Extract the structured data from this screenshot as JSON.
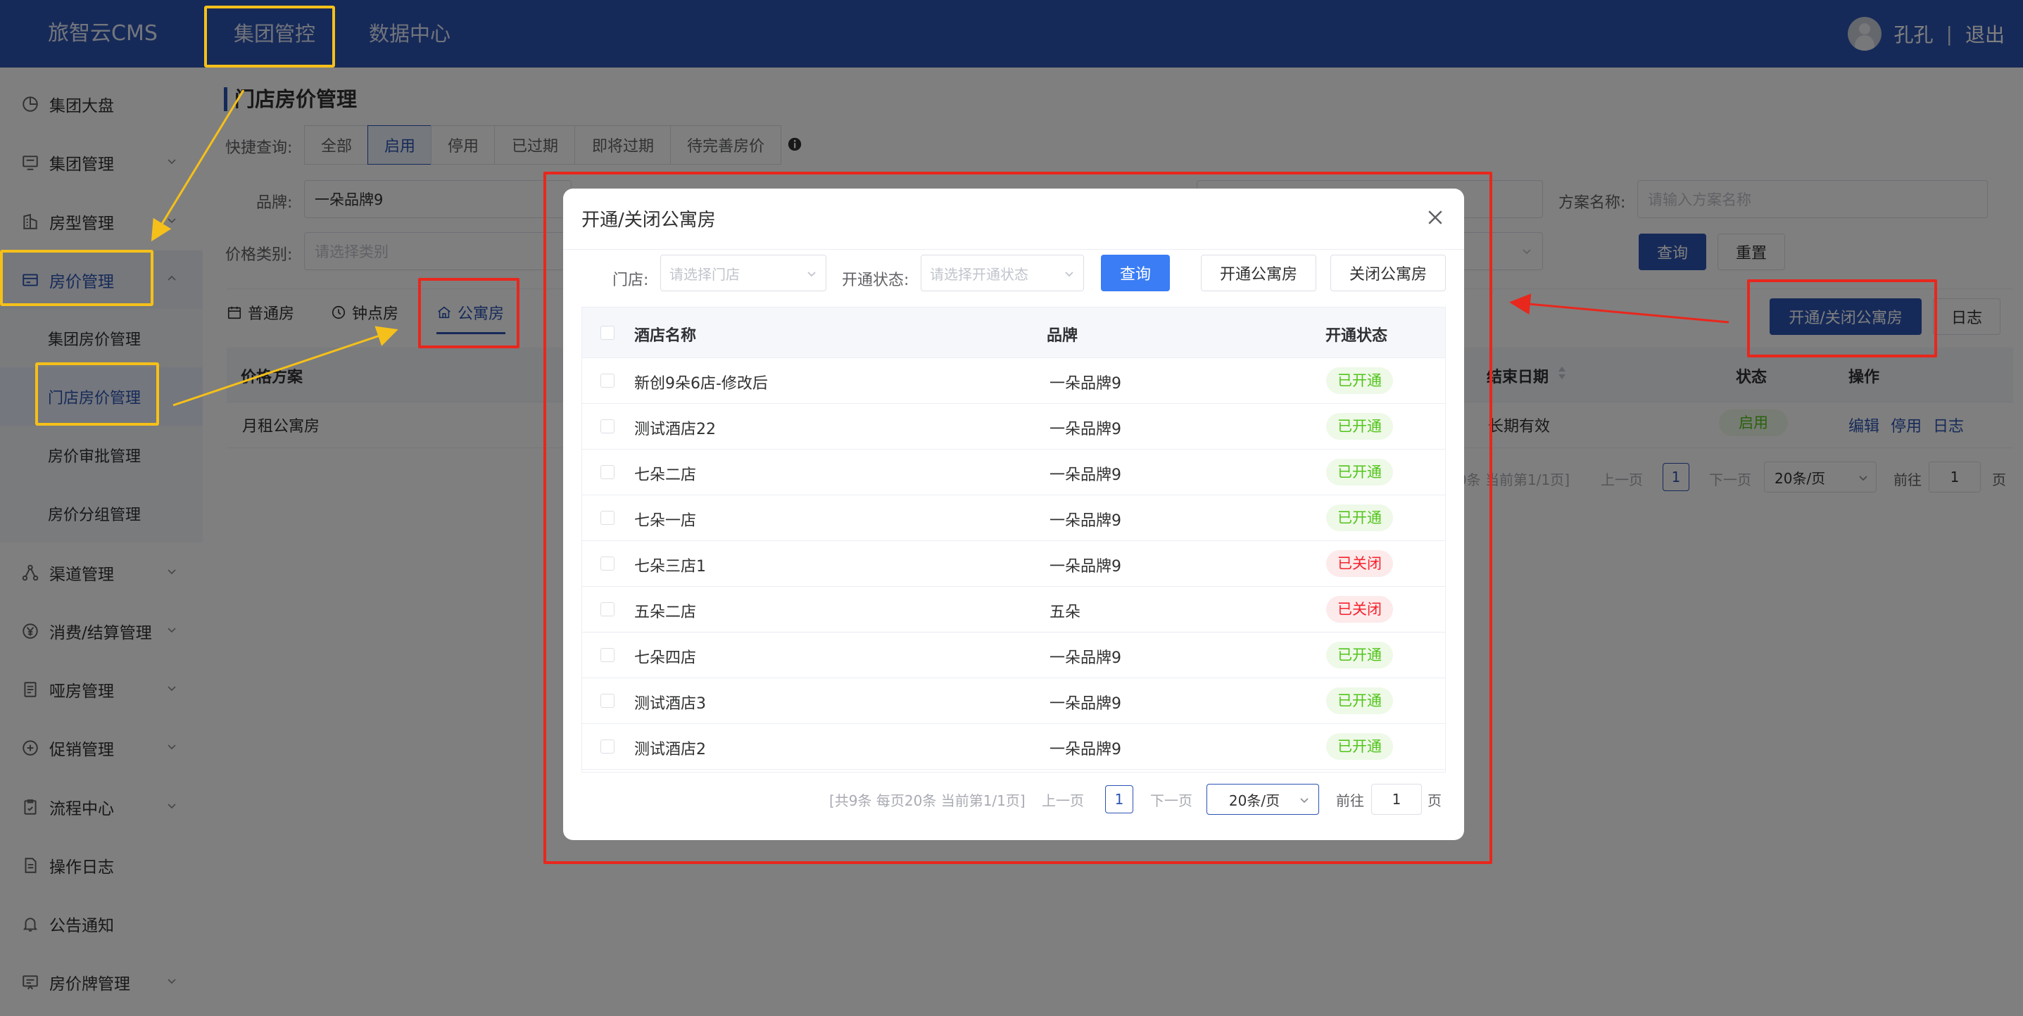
{
  "app": {
    "logo": "旅智云CMS",
    "top_nav": [
      "集团管控",
      "数据中心"
    ],
    "user_name": "孔孔",
    "separator": "|",
    "logout": "退出"
  },
  "sidebar": {
    "items": [
      {
        "label": "集团大盘",
        "icon": "pie-chart-icon"
      },
      {
        "label": "集团管理",
        "icon": "monitor-icon"
      },
      {
        "label": "房型管理",
        "icon": "building-icon"
      },
      {
        "label": "房价管理",
        "icon": "card-icon"
      },
      {
        "label": "渠道管理",
        "icon": "network-icon"
      },
      {
        "label": "消费/结算管理",
        "icon": "yen-icon"
      },
      {
        "label": "哑房管理",
        "icon": "document-icon"
      },
      {
        "label": "促销管理",
        "icon": "promo-icon"
      },
      {
        "label": "流程中心",
        "icon": "clipboard-icon"
      },
      {
        "label": "操作日志",
        "icon": "log-icon"
      },
      {
        "label": "公告通知",
        "icon": "bell-icon"
      },
      {
        "label": "房价牌管理",
        "icon": "board-icon"
      }
    ],
    "sub_items": [
      "集团房价管理",
      "门店房价管理",
      "房价审批管理",
      "房价分组管理"
    ]
  },
  "page": {
    "title": "门店房价管理",
    "quick_label": "快捷查询:",
    "quick_filters": [
      "全部",
      "启用",
      "停用",
      "已过期",
      "即将过期",
      "待完善房价"
    ],
    "brand_label": "品牌:",
    "brand_value": "一朵品牌9",
    "price_type_label": "价格类别:",
    "price_type_placeholder": "请选择类别",
    "plan_label": "方案名称:",
    "plan_placeholder": "请输入方案名称",
    "query_btn": "查询",
    "reset_btn": "重置",
    "tabs": [
      "普通房",
      "钟点房",
      "公寓房"
    ],
    "apartment_toggle_btn": "开通/关闭公寓房",
    "log_btn": "日志",
    "table_headers": [
      "价格方案",
      "结束日期",
      "状态",
      "操作"
    ],
    "row": {
      "plan": "月租公寓房",
      "end": "长期有效",
      "status": "启用",
      "actions": [
        "编辑",
        "停用",
        "日志"
      ]
    },
    "pagination": {
      "summary": "[共0条 每页20条 当前第1/1页]",
      "prev": "上一页",
      "page": "1",
      "next": "下一页",
      "size": "20条/页",
      "goto": "前往",
      "goto_value": "1",
      "page_unit": "页"
    }
  },
  "modal": {
    "title": "开通/关闭公寓房",
    "store_label": "门店:",
    "store_placeholder": "请选择门店",
    "status_label": "开通状态:",
    "status_placeholder": "请选择开通状态",
    "query_btn": "查询",
    "open_btn": "开通公寓房",
    "close_btn": "关闭公寓房",
    "headers": [
      "酒店名称",
      "品牌",
      "开通状态"
    ],
    "rows": [
      {
        "name": "新创9朵6店-修改后",
        "brand": "一朵品牌9",
        "status": "已开通",
        "on": true
      },
      {
        "name": "测试酒店22",
        "brand": "一朵品牌9",
        "status": "已开通",
        "on": true
      },
      {
        "name": "七朵二店",
        "brand": "一朵品牌9",
        "status": "已开通",
        "on": true
      },
      {
        "name": "七朵一店",
        "brand": "一朵品牌9",
        "status": "已开通",
        "on": true
      },
      {
        "name": "七朵三店1",
        "brand": "一朵品牌9",
        "status": "已关闭",
        "on": false
      },
      {
        "name": "五朵二店",
        "brand": "五朵",
        "status": "已关闭",
        "on": false
      },
      {
        "name": "七朵四店",
        "brand": "一朵品牌9",
        "status": "已开通",
        "on": true
      },
      {
        "name": "测试酒店3",
        "brand": "一朵品牌9",
        "status": "已开通",
        "on": true
      },
      {
        "name": "测试酒店2",
        "brand": "一朵品牌9",
        "status": "已开通",
        "on": true
      }
    ],
    "pagination": {
      "summary": "[共9条 每页20条 当前第1/1页]",
      "prev": "上一页",
      "page": "1",
      "next": "下一页",
      "size": "20条/页",
      "goto": "前往",
      "goto_value": "1",
      "page_unit": "页"
    }
  },
  "colors": {
    "brand": "#2c54b2",
    "highlight_yellow": "#f5c01a",
    "annotation_red": "#e8271d",
    "status_on": "#52c41a",
    "status_off": "#f5222d"
  }
}
